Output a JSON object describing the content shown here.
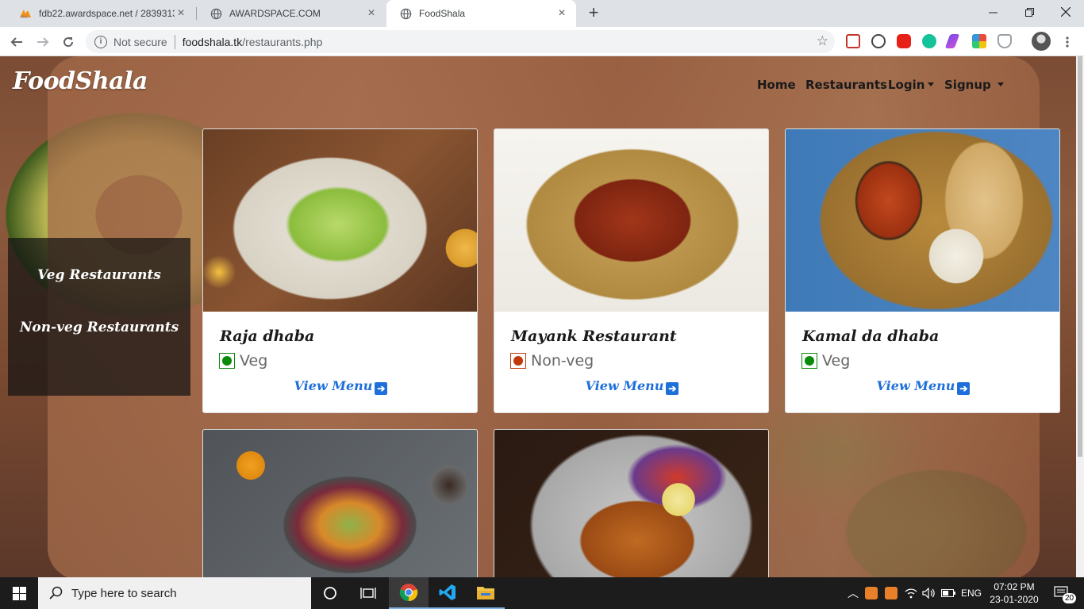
{
  "browser": {
    "tabs": [
      {
        "title": "fdb22.awardspace.net / 283931392...",
        "active": false
      },
      {
        "title": "AWARDSPACE.COM",
        "active": false
      },
      {
        "title": "FoodShala",
        "active": true
      }
    ],
    "security": "Not secure",
    "url_host": "foodshala.tk",
    "url_path": "/restaurants.php"
  },
  "site": {
    "brand": "FoodShala",
    "nav": {
      "home": "Home",
      "restaurants": "Restaurants",
      "login": "Login",
      "signup": "Signup"
    },
    "sidebar": {
      "veg": "Veg Restaurants",
      "nonveg": "Non-veg Restaurants"
    },
    "restaurants": [
      {
        "name": "Raja dhaba",
        "type": "Veg",
        "type_color": "#0a8a0a",
        "cta": "View Menu"
      },
      {
        "name": "Mayank Restaurant",
        "type": "Non-veg",
        "type_color": "#c0390b",
        "cta": "View Menu"
      },
      {
        "name": "Kamal da dhaba",
        "type": "Veg",
        "type_color": "#0a8a0a",
        "cta": "View Menu"
      }
    ]
  },
  "taskbar": {
    "search_placeholder": "Type here to search",
    "lang": "ENG",
    "time": "07:02 PM",
    "date": "23-01-2020",
    "notifications": "20"
  }
}
